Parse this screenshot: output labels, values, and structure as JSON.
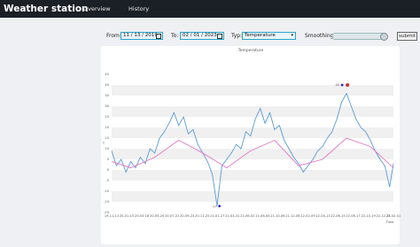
{
  "navbar": {
    "brand": "Weather station",
    "links": [
      "Overview",
      "History"
    ]
  },
  "filters": {
    "from_label": "From:",
    "from_value": "11 / 13 / 2019",
    "to_label": "To:",
    "to_value": "02 / 01 / 2023",
    "type_label": "Typ:",
    "type_value": "Temperature",
    "smoothing_label": "Smoothing:",
    "submit_label": "submit"
  },
  "colors": {
    "navbar": "#1b2026",
    "raw_series": "#5b9bd5",
    "smoothed_series": "#e377c2",
    "marker": "#1f1fcc",
    "pin": "#c0392b"
  },
  "chart_data": {
    "type": "line",
    "title": "Temperature",
    "xlabel": "Time",
    "ylabel": "T",
    "ylim": [
      -20,
      45
    ],
    "y_ticks": [
      -20,
      -15,
      -10,
      -5,
      0,
      5,
      10,
      15,
      20,
      25,
      30,
      35,
      40,
      45
    ],
    "x_tick_labels": [
      "19-11-13",
      "20-01-15",
      "20-03-18",
      "20-05-20",
      "20-07-22",
      "20-09-23",
      "20-11-25",
      "21-01-27",
      "21-03-31",
      "21-06-02",
      "21-08-04",
      "21-10-06",
      "21-12-08",
      "22-02-09",
      "22-04-13",
      "22-06-15",
      "22-08-17",
      "22-10-19",
      "22-12-21",
      "23-02-01"
    ],
    "grid": "horizontal bands",
    "annotations": [
      {
        "label": "40",
        "x": "22-07-02",
        "y": 40
      },
      {
        "label": "-17",
        "x": "21-02-05",
        "y": -17
      }
    ],
    "series": [
      {
        "style": "raw",
        "x": [
          "19-11-13",
          "19-12-03",
          "19-12-23",
          "20-01-12",
          "20-02-01",
          "20-02-21",
          "20-03-12",
          "20-04-01",
          "20-04-21",
          "20-05-11",
          "20-05-31",
          "20-06-20",
          "20-07-10",
          "20-07-30",
          "20-08-19",
          "20-09-08",
          "20-09-28",
          "20-10-18",
          "20-11-07",
          "20-11-27",
          "20-12-17",
          "21-01-06",
          "21-01-26",
          "21-02-15",
          "21-03-07",
          "21-03-27",
          "21-04-16",
          "21-05-06",
          "21-05-26",
          "21-06-15",
          "21-07-05",
          "21-07-25",
          "21-08-14",
          "21-09-03",
          "21-09-23",
          "21-10-13",
          "21-11-02",
          "21-11-22",
          "21-12-12",
          "22-01-01",
          "22-01-21",
          "22-02-10",
          "22-03-02",
          "22-03-22",
          "22-04-11",
          "22-05-01",
          "22-05-21",
          "22-06-10",
          "22-06-30",
          "22-07-20",
          "22-08-09",
          "22-08-29",
          "22-09-18",
          "22-10-08",
          "22-10-28",
          "22-11-17",
          "22-12-07",
          "22-12-27",
          "23-01-16",
          "23-02-01"
        ],
        "values": [
          9,
          2,
          5,
          -1,
          4,
          1,
          6,
          3,
          10,
          8,
          15,
          18,
          22,
          27,
          21,
          25,
          17,
          19,
          12,
          8,
          4,
          -2,
          -17,
          2,
          5,
          8,
          12,
          10,
          18,
          16,
          24,
          29,
          22,
          27,
          19,
          21,
          14,
          10,
          6,
          3,
          -1,
          2,
          5,
          9,
          11,
          15,
          18,
          24,
          32,
          36,
          30,
          24,
          20,
          18,
          14,
          9,
          5,
          2,
          -8,
          3
        ]
      },
      {
        "style": "smoothed",
        "x": [
          "19-11-13",
          "20-02-01",
          "20-05-11",
          "20-08-19",
          "20-11-27",
          "21-03-07",
          "21-06-15",
          "21-09-23",
          "22-01-01",
          "22-04-11",
          "22-07-20",
          "22-10-28",
          "23-02-01"
        ],
        "values": [
          4,
          1,
          6,
          14,
          8,
          1,
          9,
          14,
          2,
          5,
          15,
          11,
          1
        ]
      }
    ]
  }
}
